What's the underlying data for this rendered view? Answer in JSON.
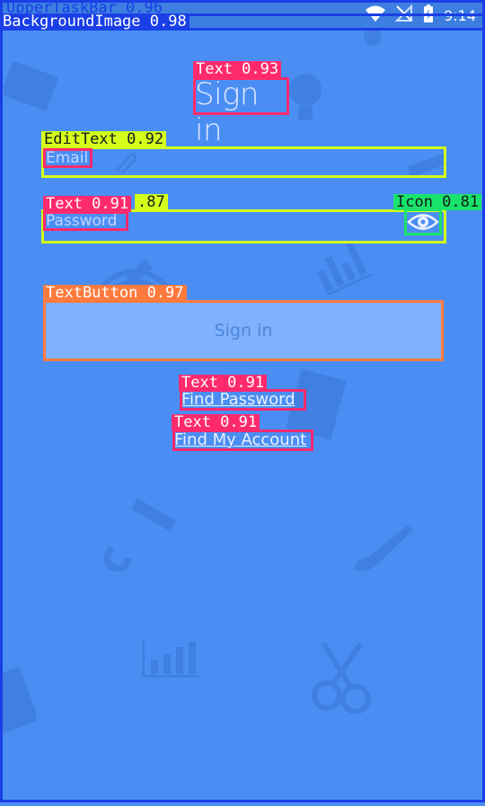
{
  "status_bar": {
    "time": "9:14",
    "icons": [
      "wifi-icon",
      "no-signal-icon",
      "battery-charging-icon"
    ]
  },
  "login": {
    "title": "Sign in",
    "email_placeholder": "Email",
    "password_placeholder": "Password",
    "password_visibility_icon": "eye-icon",
    "signin_label": "Sign in",
    "find_password": "Find Password",
    "find_account": "Find My Account"
  },
  "annotations": {
    "upper_task_bar": "UpperTaskBar 0.96",
    "background_image": "BackgroundImage 0.98",
    "title_text": "Text 0.93",
    "email_edittext": "EditText 0.92",
    "password_edittext_score": ".87",
    "password_text": "Text 0.91",
    "eye_icon": "Icon 0.81",
    "signin_textbutton": "TextButton 0.97",
    "find_password_text": "Text 0.91",
    "find_account_text": "Text 0.91"
  },
  "colors": {
    "background": "#4a8ef4",
    "blue_box": "#1a3fe6",
    "pink_box": "#ff2a6d",
    "yellow_box": "#d4ff1a",
    "green_box": "#19e36b",
    "orange_box": "#ff7a3d"
  }
}
